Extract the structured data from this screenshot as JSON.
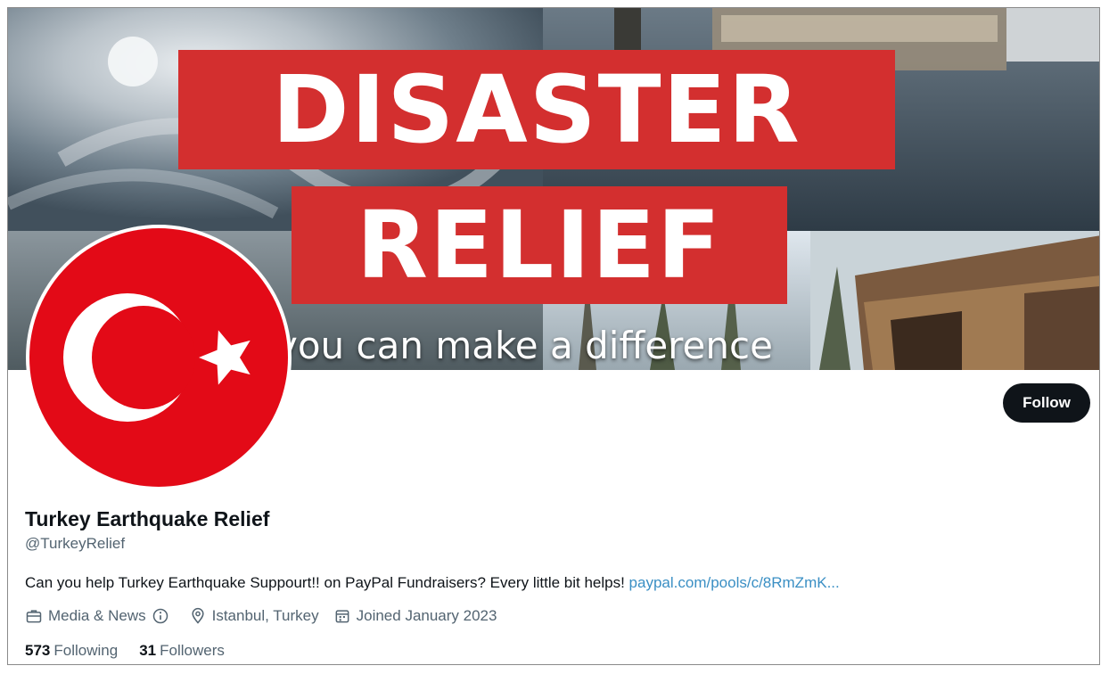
{
  "banner": {
    "title_line1": "DISASTER",
    "title_line2": "RELIEF",
    "tagline": "you can make a difference"
  },
  "profile": {
    "display_name": "Turkey Earthquake Relief",
    "handle": "@TurkeyRelief",
    "follow_label": "Follow",
    "bio_text": "Can you help Turkey Earthquake Suppourt!! on PayPal Fundraisers? Every little bit helps! ",
    "bio_link": "paypal.com/pools/c/8RmZmK...",
    "category": "Media & News",
    "location": "Istanbul, Turkey",
    "joined": "Joined January 2023",
    "following_count": "573",
    "following_label": "Following",
    "followers_count": "31",
    "followers_label": "Followers"
  },
  "icons": {
    "category": "briefcase-icon",
    "info": "info-icon",
    "location": "location-pin-icon",
    "joined": "calendar-icon"
  },
  "colors": {
    "flag_red": "#e30a17",
    "banner_red": "#d32f2f",
    "follow_bg": "#0f1419",
    "link": "#3a8fc4",
    "muted_text": "#536471"
  }
}
